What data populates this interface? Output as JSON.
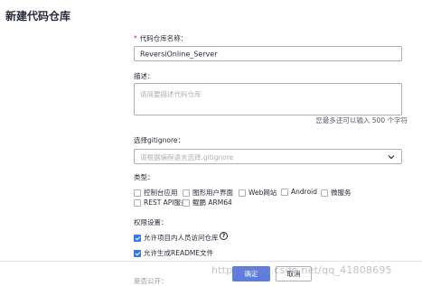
{
  "page": {
    "title": "新建代码仓库"
  },
  "repo_name": {
    "label": "代码仓库名称：",
    "required_mark": "*",
    "value": "ReversiOnline_Server"
  },
  "description": {
    "label": "描述：",
    "placeholder": "请简要描述代码仓库",
    "counter": "您最多还可以输入 500 个字符"
  },
  "gitignore": {
    "label": "选择gitignore：",
    "placeholder": "请根据编程语言选择.gitignore"
  },
  "type": {
    "label": "类型：",
    "options_row1": [
      {
        "label": "控制台应用",
        "checked": false
      },
      {
        "label": "图形用户界面",
        "checked": false
      },
      {
        "label": "Web网站",
        "checked": false
      },
      {
        "label": "Android",
        "checked": false
      },
      {
        "label": "微服务",
        "checked": false
      }
    ],
    "options_row2": [
      {
        "label": "REST API服务",
        "checked": false
      },
      {
        "label": "鲲鹏 ARM64",
        "checked": false
      }
    ]
  },
  "permissions": {
    "label": "权限设置：",
    "allow_members": {
      "label": "允许项目内人员访问仓库",
      "checked": true
    },
    "allow_readme": {
      "label": "允许生成README文件",
      "checked": true
    },
    "help_icon": "?"
  },
  "footer": {
    "confirm_label": "确定",
    "cancel_label": "取消",
    "partial_label": "是否公开："
  },
  "watermark": "https://blog.csdn.net/qq_41808695",
  "colors": {
    "accent": "#5e7ce0",
    "checkbox_on": "#3776e8",
    "required": "#e02020"
  }
}
